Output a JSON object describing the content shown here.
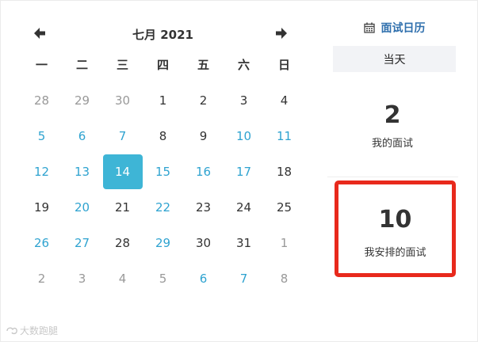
{
  "calendar": {
    "month_title": "七月 2021",
    "weekdays": [
      "一",
      "二",
      "三",
      "四",
      "五",
      "六",
      "日"
    ],
    "weeks": [
      [
        {
          "d": "28",
          "s": "muted"
        },
        {
          "d": "29",
          "s": "muted"
        },
        {
          "d": "30",
          "s": "muted"
        },
        {
          "d": "1",
          "s": "normal"
        },
        {
          "d": "2",
          "s": "normal"
        },
        {
          "d": "3",
          "s": "normal"
        },
        {
          "d": "4",
          "s": "normal"
        }
      ],
      [
        {
          "d": "5",
          "s": "event"
        },
        {
          "d": "6",
          "s": "event"
        },
        {
          "d": "7",
          "s": "event"
        },
        {
          "d": "8",
          "s": "normal"
        },
        {
          "d": "9",
          "s": "normal"
        },
        {
          "d": "10",
          "s": "event"
        },
        {
          "d": "11",
          "s": "event"
        }
      ],
      [
        {
          "d": "12",
          "s": "event"
        },
        {
          "d": "13",
          "s": "event"
        },
        {
          "d": "14",
          "s": "today"
        },
        {
          "d": "15",
          "s": "event"
        },
        {
          "d": "16",
          "s": "event"
        },
        {
          "d": "17",
          "s": "event"
        },
        {
          "d": "18",
          "s": "normal"
        }
      ],
      [
        {
          "d": "19",
          "s": "normal"
        },
        {
          "d": "20",
          "s": "event"
        },
        {
          "d": "21",
          "s": "normal"
        },
        {
          "d": "22",
          "s": "event"
        },
        {
          "d": "23",
          "s": "normal"
        },
        {
          "d": "24",
          "s": "normal"
        },
        {
          "d": "25",
          "s": "normal"
        }
      ],
      [
        {
          "d": "26",
          "s": "event"
        },
        {
          "d": "27",
          "s": "event"
        },
        {
          "d": "28",
          "s": "normal"
        },
        {
          "d": "29",
          "s": "event"
        },
        {
          "d": "30",
          "s": "normal"
        },
        {
          "d": "31",
          "s": "normal"
        },
        {
          "d": "1",
          "s": "muted"
        }
      ],
      [
        {
          "d": "2",
          "s": "muted"
        },
        {
          "d": "3",
          "s": "muted"
        },
        {
          "d": "4",
          "s": "muted"
        },
        {
          "d": "5",
          "s": "muted"
        },
        {
          "d": "6",
          "s": "event"
        },
        {
          "d": "7",
          "s": "event"
        },
        {
          "d": "8",
          "s": "muted"
        }
      ]
    ]
  },
  "sidebar": {
    "title": "面试日历",
    "today_button": "当天",
    "my_interviews": {
      "count": "2",
      "label": "我的面试"
    },
    "arranged_interviews": {
      "count": "10",
      "label": "我安排的面试"
    }
  },
  "watermark": {
    "text": "大数跑腿"
  },
  "colors": {
    "accent": "#3eb5d6",
    "event_day": "#2fa3d0",
    "title_link": "#2f6fad",
    "highlight_border": "#e8291c",
    "muted": "#999999"
  }
}
